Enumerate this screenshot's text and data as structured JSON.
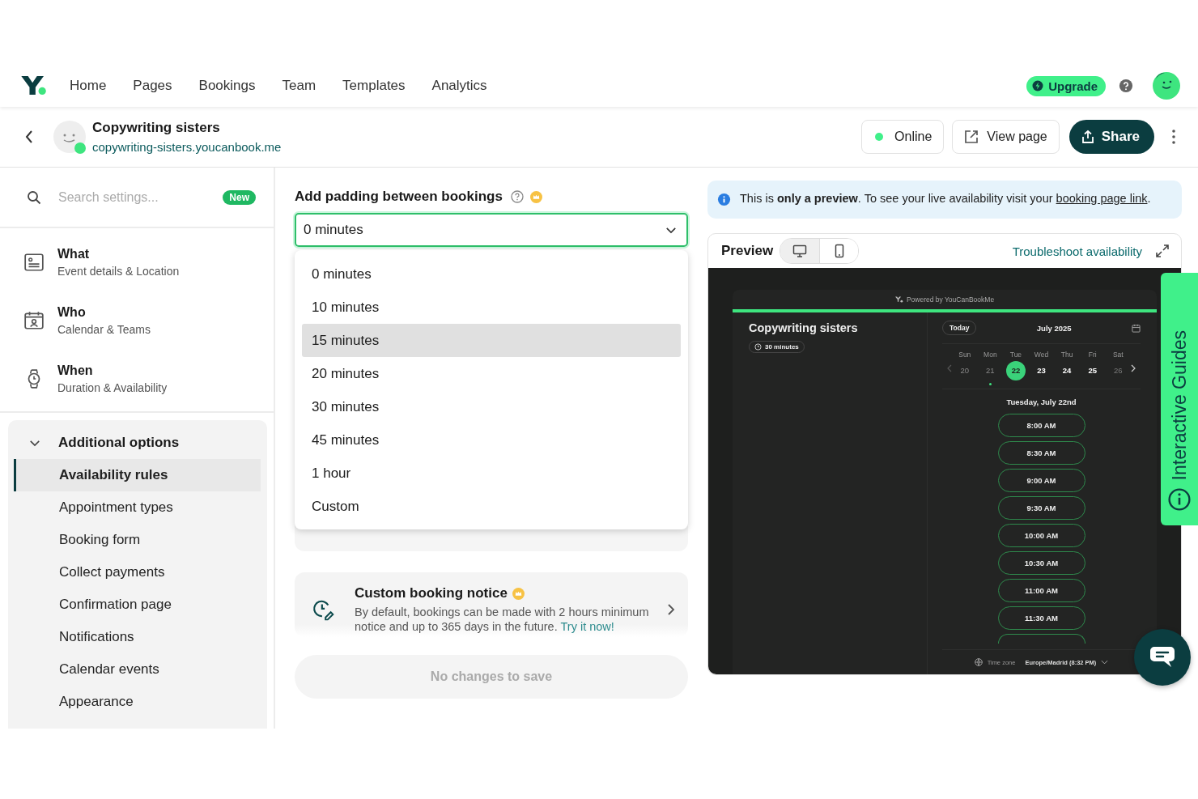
{
  "nav": {
    "items": [
      {
        "label": "Home"
      },
      {
        "label": "Pages"
      },
      {
        "label": "Bookings"
      },
      {
        "label": "Team"
      },
      {
        "label": "Templates"
      },
      {
        "label": "Analytics"
      }
    ],
    "upgrade": "Upgrade"
  },
  "header": {
    "title": "Copywriting sisters",
    "url": "copywriting-sisters.youcanbook.me",
    "status": {
      "label": "Online",
      "online": true
    },
    "view_page": "View page",
    "share": "Share"
  },
  "sidebar": {
    "search_placeholder": "Search settings...",
    "badge": "New",
    "sections": [
      {
        "kind": "what",
        "title": "What",
        "subtitle": "Event details & Location"
      },
      {
        "kind": "who",
        "title": "Who",
        "subtitle": "Calendar & Teams"
      },
      {
        "kind": "when",
        "title": "When",
        "subtitle": "Duration & Availability"
      }
    ],
    "group": {
      "title": "Additional options",
      "expanded": true,
      "items": [
        {
          "label": "Availability rules",
          "selected": true
        },
        {
          "label": "Appointment types",
          "selected": false
        },
        {
          "label": "Booking form",
          "selected": false
        },
        {
          "label": "Collect payments",
          "selected": false
        },
        {
          "label": "Confirmation page",
          "selected": false
        },
        {
          "label": "Notifications",
          "selected": false
        },
        {
          "label": "Calendar events",
          "selected": false
        },
        {
          "label": "Appearance",
          "selected": false
        }
      ]
    }
  },
  "setting": {
    "label": "Add padding between bookings",
    "premium": true,
    "value": "0 minutes",
    "open": true,
    "options": [
      {
        "label": "0 minutes",
        "highlighted": false
      },
      {
        "label": "10 minutes",
        "highlighted": false
      },
      {
        "label": "15 minutes",
        "highlighted": true
      },
      {
        "label": "20 minutes",
        "highlighted": false
      },
      {
        "label": "30 minutes",
        "highlighted": false
      },
      {
        "label": "45 minutes",
        "highlighted": false
      },
      {
        "label": "1 hour",
        "highlighted": false
      },
      {
        "label": "Custom",
        "highlighted": false
      }
    ]
  },
  "cards": [
    {
      "title": "Custom booking notice",
      "premium": true,
      "description": "By default, bookings can be made with 2 hours minimum notice and up to 365 days in the future.",
      "link": "Try it now!"
    }
  ],
  "save_button": {
    "label": "No changes to save",
    "disabled": true
  },
  "notice": {
    "before": "This is **only a preview**. To see your live availability visit your",
    "link": "booking page link",
    "after": "."
  },
  "preview": {
    "title": "Preview",
    "devices": [
      {
        "kind": "desktop",
        "selected": true
      },
      {
        "kind": "mobile",
        "selected": false
      }
    ],
    "troubleshoot": "Troubleshoot availability",
    "powered_by": "Powered by YouCanBookMe",
    "page_title": "Copywriting sisters",
    "duration": "30 minutes",
    "today": "Today",
    "month": "July 2025",
    "days": [
      {
        "weekday": "Sun",
        "date": "20",
        "kind": "past",
        "dot": false
      },
      {
        "weekday": "Mon",
        "date": "21",
        "kind": "past",
        "dot": true
      },
      {
        "weekday": "Tue",
        "date": "22",
        "kind": "selected",
        "dot": false
      },
      {
        "weekday": "Wed",
        "date": "23",
        "kind": "available",
        "dot": false
      },
      {
        "weekday": "Thu",
        "date": "24",
        "kind": "available",
        "dot": false
      },
      {
        "weekday": "Fri",
        "date": "25",
        "kind": "available",
        "dot": false
      },
      {
        "weekday": "Sat",
        "date": "26",
        "kind": "unavailable",
        "dot": false
      }
    ],
    "date_heading": "Tuesday, July 22nd",
    "slots": [
      "8:00 AM",
      "8:30 AM",
      "9:00 AM",
      "9:30 AM",
      "10:00 AM",
      "10:30 AM",
      "11:00 AM",
      "11:30 AM"
    ],
    "timezone_label": "Time zone",
    "timezone": "Europe/Madrid (8:32 PM)"
  },
  "guides_tab": "Interactive Guides"
}
